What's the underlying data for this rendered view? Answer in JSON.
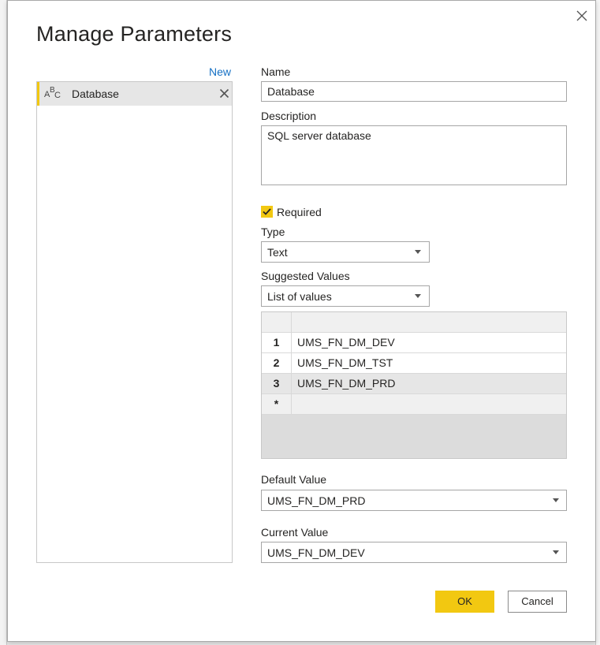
{
  "dialog": {
    "title": "Manage Parameters",
    "new_link": "New",
    "ok_label": "OK",
    "cancel_label": "Cancel"
  },
  "parameters": [
    {
      "name": "Database",
      "type_icon": "abc-text-type-icon"
    }
  ],
  "form": {
    "name_label": "Name",
    "name_value": "Database",
    "description_label": "Description",
    "description_value": "SQL server database",
    "required_label": "Required",
    "required_checked": true,
    "type_label": "Type",
    "type_value": "Text",
    "suggested_label": "Suggested Values",
    "suggested_value": "List of values",
    "values_list": [
      {
        "num": "1",
        "value": "UMS_FN_DM_DEV"
      },
      {
        "num": "2",
        "value": "UMS_FN_DM_TST"
      },
      {
        "num": "3",
        "value": "UMS_FN_DM_PRD"
      },
      {
        "num": "*",
        "value": ""
      }
    ],
    "default_label": "Default Value",
    "default_value": "UMS_FN_DM_PRD",
    "current_label": "Current Value",
    "current_value": "UMS_FN_DM_DEV"
  },
  "colors": {
    "accent": "#f2c811",
    "link": "#1570c4"
  }
}
